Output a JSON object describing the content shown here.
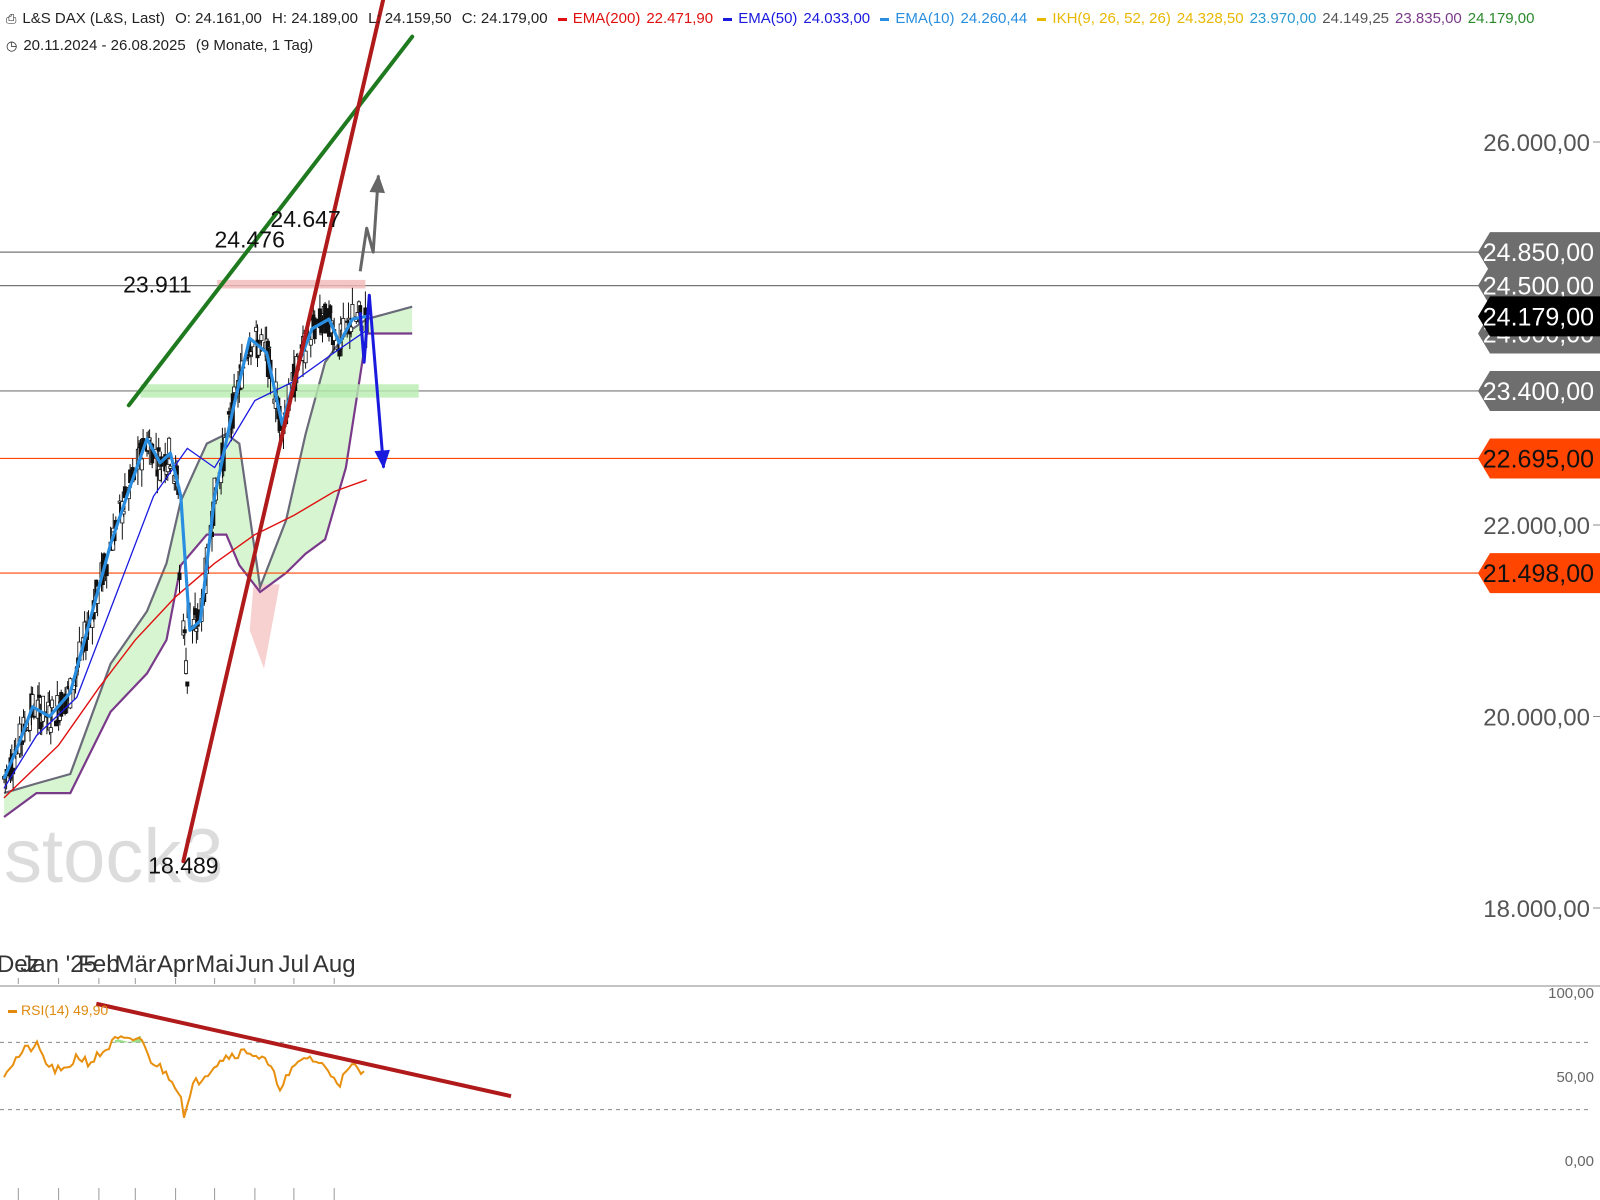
{
  "header": {
    "symbol": "L&S DAX (L&S, Last)",
    "open": "O: 24.161,00",
    "high": "H: 24.189,00",
    "low": "L: 24.159,50",
    "close": "C: 24.179,00",
    "ema200_label": "EMA(200)",
    "ema200_value": "22.471,90",
    "ema50_label": "EMA(50)",
    "ema50_value": "24.033,00",
    "ema10_label": "EMA(10)",
    "ema10_value": "24.260,44",
    "ikh_label": "IKH(9, 26, 52, 26)",
    "ikh_v1": "24.328,50",
    "ikh_v2": "23.970,00",
    "ikh_v3": "24.149,25",
    "ikh_v4": "23.835,00",
    "ikh_v5": "24.179,00",
    "period": "20.11.2024 - 26.08.2025",
    "period_note": "(9 Monate, 1 Tag)"
  },
  "rsi_legend": "RSI(14) 49,90",
  "watermark": "stock3",
  "colors": {
    "up": "#ffffff",
    "down": "#111111",
    "ema200": "#e01010",
    "ema50": "#1a1adf",
    "ema10": "#2a8ee0",
    "green_trend": "#1f7a1f",
    "red_trend": "#b01a1a",
    "cloud_green": "#d6f5d0",
    "cloud_red": "#f7d0d0",
    "orange_level": "#ff4400",
    "rsi": "#e8900e"
  },
  "chart_data": [
    {
      "type": "candlestick",
      "title": "L&S DAX",
      "x_tick_labels": [
        "Dez",
        "Jan '25",
        "Feb",
        "Mär",
        "Apr",
        "Mai",
        "Jun",
        "Jul",
        "Aug"
      ],
      "y_tick_labels": [
        "26.000,00",
        "22.000,00",
        "20.000,00",
        "18.000,00"
      ],
      "ylim": [
        17900,
        27800
      ],
      "price_tags": [
        {
          "label": "24.850,00",
          "value": 24850,
          "style": "gray"
        },
        {
          "label": "24.500,00",
          "value": 24500,
          "style": "gray"
        },
        {
          "label": "24.000,00",
          "value": 24000,
          "style": "gray"
        },
        {
          "label": "24.179,00",
          "value": 24179,
          "style": "black"
        },
        {
          "label": "23.400,00",
          "value": 23400,
          "style": "gray"
        },
        {
          "label": "22.695,00",
          "value": 22695,
          "style": "orange"
        },
        {
          "label": "21.498,00",
          "value": 21498,
          "style": "orange"
        }
      ],
      "horizontal_lines": [
        24850,
        24500,
        23400,
        22695,
        21498
      ],
      "annotations": [
        {
          "text": "24.476",
          "date": "2025-05-28",
          "value": 24900
        },
        {
          "text": "24.647",
          "date": "2025-07-10",
          "value": 25110
        },
        {
          "text": "23.911",
          "date": "2025-03-18",
          "value": 24430
        },
        {
          "text": "18.489",
          "date": "2025-04-07",
          "value": 18360
        }
      ],
      "resistance_zone": [
        24470,
        24560
      ],
      "support_zone": [
        23330,
        23470
      ],
      "trendlines": [
        {
          "name": "green",
          "from": [
            "2025-02-24",
            23250
          ],
          "to": [
            "2025-09-30",
            27100
          ]
        },
        {
          "name": "red",
          "from": [
            "2025-04-07",
            18489
          ],
          "to": [
            "2025-09-25",
            28500
          ]
        }
      ],
      "scenario_up": [
        [
          "2025-08-21",
          24650
        ],
        [
          "2025-08-26",
          25100
        ],
        [
          "2025-08-31",
          24850
        ],
        [
          "2025-09-04",
          25650
        ]
      ],
      "scenario_down": [
        [
          "2025-08-21",
          24220
        ],
        [
          "2025-08-24",
          23700
        ],
        [
          "2025-08-28",
          24400
        ],
        [
          "2025-09-08",
          22600
        ]
      ],
      "ema200": [
        [
          "2024-11-20",
          19150
        ],
        [
          "2025-01-01",
          19700
        ],
        [
          "2025-02-01",
          20300
        ],
        [
          "2025-03-01",
          20800
        ],
        [
          "2025-04-01",
          21250
        ],
        [
          "2025-05-01",
          21600
        ],
        [
          "2025-06-01",
          21900
        ],
        [
          "2025-07-01",
          22100
        ],
        [
          "2025-08-01",
          22350
        ],
        [
          "2025-08-26",
          22471.9
        ]
      ],
      "ema50": [
        [
          "2024-11-20",
          19250
        ],
        [
          "2024-12-15",
          19800
        ],
        [
          "2025-01-15",
          20200
        ],
        [
          "2025-02-15",
          21300
        ],
        [
          "2025-03-15",
          22300
        ],
        [
          "2025-04-10",
          22800
        ],
        [
          "2025-05-01",
          22600
        ],
        [
          "2025-06-01",
          23300
        ],
        [
          "2025-07-01",
          23500
        ],
        [
          "2025-08-01",
          23800
        ],
        [
          "2025-08-26",
          24033
        ]
      ],
      "ema10": [
        [
          "2024-11-20",
          19350
        ],
        [
          "2024-12-01",
          19700
        ],
        [
          "2024-12-12",
          20100
        ],
        [
          "2024-12-25",
          20000
        ],
        [
          "2025-01-10",
          20250
        ],
        [
          "2025-01-25",
          21000
        ],
        [
          "2025-02-10",
          21800
        ],
        [
          "2025-02-25",
          22400
        ],
        [
          "2025-03-10",
          22900
        ],
        [
          "2025-03-20",
          22650
        ],
        [
          "2025-03-28",
          22750
        ],
        [
          "2025-04-05",
          22300
        ],
        [
          "2025-04-12",
          20900
        ],
        [
          "2025-04-20",
          21000
        ],
        [
          "2025-05-01",
          22300
        ],
        [
          "2025-05-15",
          23200
        ],
        [
          "2025-05-28",
          23950
        ],
        [
          "2025-06-10",
          23800
        ],
        [
          "2025-06-22",
          23050
        ],
        [
          "2025-07-05",
          23700
        ],
        [
          "2025-07-15",
          24050
        ],
        [
          "2025-07-28",
          24150
        ],
        [
          "2025-08-05",
          23900
        ],
        [
          "2025-08-15",
          24150
        ],
        [
          "2025-08-26",
          24180
        ]
      ],
      "ikh_upper": [
        [
          "2024-11-20",
          19200
        ],
        [
          "2024-12-15",
          19300
        ],
        [
          "2025-01-10",
          19400
        ],
        [
          "2025-02-10",
          20550
        ],
        [
          "2025-03-10",
          21100
        ],
        [
          "2025-03-25",
          21600
        ],
        [
          "2025-04-05",
          22250
        ],
        [
          "2025-04-25",
          22850
        ],
        [
          "2025-05-10",
          22950
        ],
        [
          "2025-05-20",
          22850
        ],
        [
          "2025-06-05",
          21350
        ],
        [
          "2025-06-25",
          22050
        ],
        [
          "2025-07-10",
          22950
        ],
        [
          "2025-07-25",
          23700
        ],
        [
          "2025-08-10",
          24000
        ],
        [
          "2025-08-26",
          24150
        ],
        [
          "2025-09-30",
          24280
        ]
      ],
      "ikh_lower": [
        [
          "2024-11-20",
          18950
        ],
        [
          "2024-12-15",
          19200
        ],
        [
          "2025-01-10",
          19200
        ],
        [
          "2025-02-10",
          20050
        ],
        [
          "2025-03-10",
          20450
        ],
        [
          "2025-03-25",
          20800
        ],
        [
          "2025-04-05",
          21580
        ],
        [
          "2025-04-25",
          21900
        ],
        [
          "2025-05-10",
          21900
        ],
        [
          "2025-05-20",
          21580
        ],
        [
          "2025-06-05",
          21300
        ],
        [
          "2025-06-25",
          21500
        ],
        [
          "2025-07-10",
          21700
        ],
        [
          "2025-07-25",
          21850
        ],
        [
          "2025-08-10",
          22600
        ],
        [
          "2025-08-26",
          24000
        ],
        [
          "2025-09-30",
          24000
        ]
      ],
      "rsi": {
        "legend": "RSI(14) 49,90",
        "y_tick_labels": [
          "100,00",
          "50,00",
          "0,00"
        ],
        "levels": [
          70,
          30
        ],
        "values": [
          [
            "2024-11-20",
            52
          ],
          [
            "2024-12-05",
            65
          ],
          [
            "2024-12-15",
            68
          ],
          [
            "2024-12-25",
            55
          ],
          [
            "2025-01-05",
            52
          ],
          [
            "2025-01-15",
            62
          ],
          [
            "2025-01-25",
            58
          ],
          [
            "2025-02-05",
            65
          ],
          [
            "2025-02-15",
            72
          ],
          [
            "2025-02-25",
            70
          ],
          [
            "2025-03-05",
            74
          ],
          [
            "2025-03-10",
            62
          ],
          [
            "2025-03-20",
            55
          ],
          [
            "2025-03-30",
            48
          ],
          [
            "2025-04-05",
            38
          ],
          [
            "2025-04-08",
            26
          ],
          [
            "2025-04-15",
            45
          ],
          [
            "2025-04-25",
            52
          ],
          [
            "2025-05-05",
            60
          ],
          [
            "2025-05-15",
            63
          ],
          [
            "2025-05-28",
            65
          ],
          [
            "2025-06-10",
            58
          ],
          [
            "2025-06-20",
            44
          ],
          [
            "2025-07-01",
            54
          ],
          [
            "2025-07-10",
            62
          ],
          [
            "2025-07-20",
            58
          ],
          [
            "2025-08-01",
            50
          ],
          [
            "2025-08-05",
            46
          ],
          [
            "2025-08-15",
            56
          ],
          [
            "2025-08-26",
            49.9
          ]
        ],
        "trendline": {
          "from": [
            "2025-01-30",
            93
          ],
          "to": [
            "2025-12-15",
            38
          ]
        }
      }
    }
  ]
}
